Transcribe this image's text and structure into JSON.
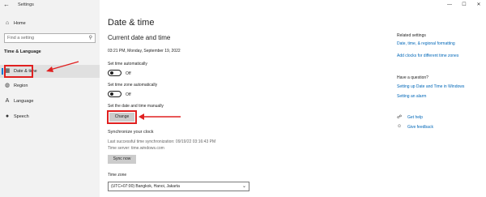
{
  "window": {
    "title": "Settings"
  },
  "sidebar": {
    "home_label": "Home",
    "search_placeholder": "Find a setting",
    "section_title": "Time & Language",
    "items": [
      {
        "label": "Date & time",
        "icon": "calendar-clock-icon",
        "selected": true
      },
      {
        "label": "Region",
        "icon": "globe-icon",
        "selected": false
      },
      {
        "label": "Language",
        "icon": "language-icon",
        "selected": false
      },
      {
        "label": "Speech",
        "icon": "microphone-icon",
        "selected": false
      }
    ]
  },
  "main": {
    "title": "Date & time",
    "current_heading": "Current date and time",
    "current_datetime": "03:21 PM, Monday, September 19, 2022",
    "set_time_auto_label": "Set time automatically",
    "set_time_auto_state": "Off",
    "set_timezone_auto_label": "Set time zone automatically",
    "set_timezone_auto_state": "Off",
    "manual_label": "Set the date and time manually",
    "change_button": "Change",
    "sync_heading": "Synchronize your clock",
    "last_sync": "Last successful time synchronization: 09/19/22 03:16:43 PM",
    "time_server": "Time server: time.windows.com",
    "sync_button": "Sync now",
    "timezone_label": "Time zone",
    "timezone_value": "(UTC+07:00) Bangkok, Hanoi, Jakarta"
  },
  "related": {
    "heading": "Related settings",
    "link1": "Date, time, & regional formatting",
    "link2": "Add clocks for different time zones",
    "question_heading": "Have a question?",
    "link3": "Setting up Date and Time in Windows",
    "link4": "Setting an alarm",
    "get_help": "Get help",
    "give_feedback": "Give feedback"
  },
  "colors": {
    "accent": "#0078d4",
    "link": "#0067b8",
    "highlight": "#e02020",
    "sidebar_bg": "#f2f2f2"
  }
}
